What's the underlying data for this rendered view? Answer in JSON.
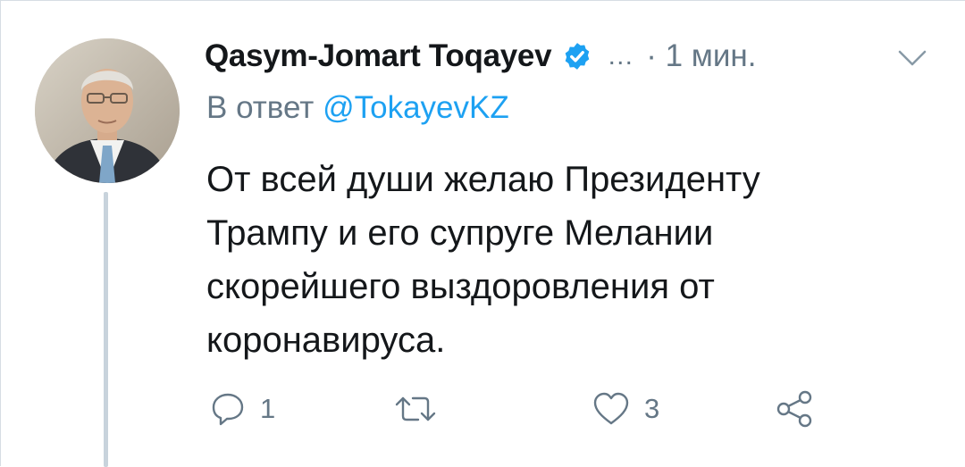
{
  "tweet": {
    "author_name": "Qasym-Jomart Toqayev",
    "ellipsis": "…",
    "time": "· 1 мин.",
    "reply_prefix": "В ответ",
    "reply_handle": "@TokayevKZ",
    "text": "От всей души желаю Президенту Трампу и его супруге Мелании скорейшего выздоровления от коронавируса.",
    "actions": {
      "reply_count": "1",
      "retweet_count": "",
      "like_count": "3"
    }
  },
  "icons": {
    "verified": "verified-badge-icon",
    "chevron": "chevron-down-icon",
    "reply": "reply-icon",
    "retweet": "retweet-icon",
    "like": "heart-icon",
    "share": "share-icon"
  },
  "colors": {
    "accent": "#1da1f2",
    "text": "#14171a",
    "secondary": "#657786",
    "thread_line": "#c8d3dc"
  }
}
